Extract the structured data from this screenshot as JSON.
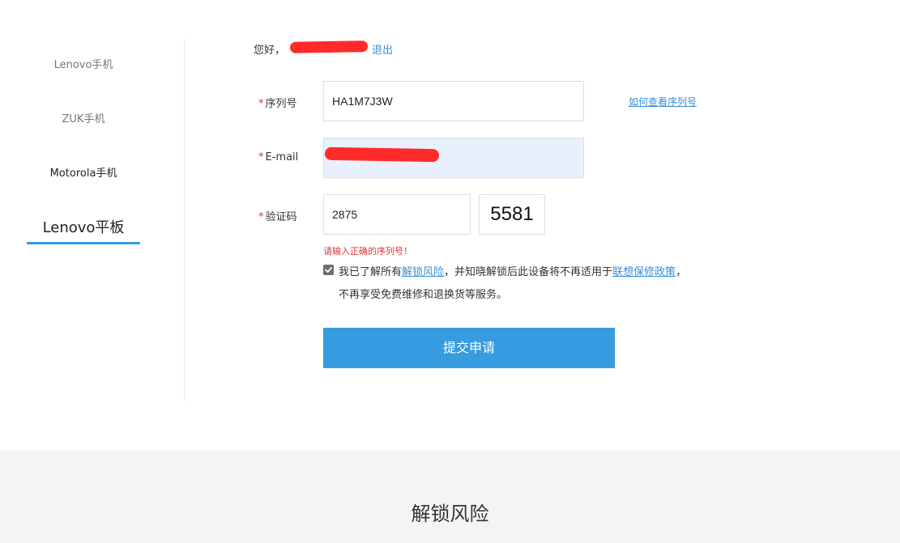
{
  "sidebar": {
    "items": [
      {
        "label": "Lenovo手机"
      },
      {
        "label": "ZUK手机"
      },
      {
        "label": "Motorola手机"
      },
      {
        "label": "Lenovo平板"
      }
    ]
  },
  "header": {
    "greeting": "您好，",
    "logout_label": "退出"
  },
  "form": {
    "required_mark": "*",
    "serial": {
      "label": "序列号",
      "value": "HA1M7J3W",
      "help_link": "如何查看序列号"
    },
    "email": {
      "label": "E-mail",
      "value": ""
    },
    "captcha": {
      "label": "验证码",
      "value": "2875",
      "image_text": "5581"
    },
    "error_message": "请输入正确的序列号！",
    "agreement": {
      "checked": true,
      "text_1": "我已了解所有",
      "link_1": "解锁风险",
      "text_2": "，并知晓解锁后此设备将不再适用于",
      "link_2": "联想保修政策",
      "text_3": "，",
      "line_2": "不再享受免费维修和退换货等服务。"
    },
    "submit_label": "提交申请"
  },
  "bottom": {
    "title": "解锁风险"
  },
  "colors": {
    "accent": "#369cdf",
    "link": "#3a8fd8",
    "error": "#e03434",
    "redaction": "#ff2b2b"
  }
}
